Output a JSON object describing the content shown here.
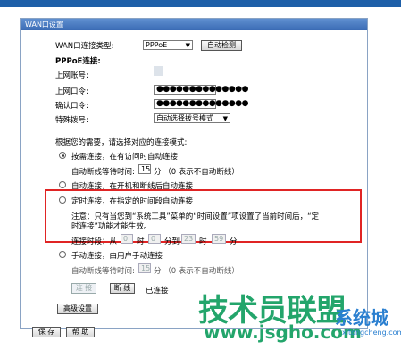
{
  "panel": {
    "title": "WAN口设置"
  },
  "conn_type": {
    "label": "WAN口连接类型:",
    "value": "PPPoE",
    "detect_button": "自动检测"
  },
  "pppoe": {
    "section": "PPPoE连接:",
    "account_label": "上网账号:",
    "password_label": "上网口令:",
    "confirm_label": "确认口令:",
    "password_mask": "●●●●●●●●●●●●●●",
    "special_label": "特殊拨号:",
    "special_value": "自动选择拨号模式"
  },
  "modes": {
    "intro": "根据您的需要，请选择对应的连接模式:",
    "on_demand": "按需连接，在有访问时自动连接",
    "idle_label": "自动断线等待时间:",
    "idle_value": "15",
    "idle_unit": "分 （0 表示不自动断线）",
    "auto": "自动连接，在开机和断线后自动连接",
    "timed": "定时连接，在指定的时间段自动连接",
    "timed_note_1": "注意：只有当您到“系统工具”菜单的“时间设置”项设置了当前时间后，“定",
    "timed_note_2": "时连接”功能才能生效。",
    "period_label": "连接时段：从",
    "from_h": "0",
    "h_unit": "时",
    "from_m": "0",
    "to_label": "分到",
    "to_h": "23",
    "to_m": "59",
    "m_unit": "分",
    "manual": "手动连接，由用户手动连接",
    "manual_idle_value": "15"
  },
  "actions": {
    "connect": "连 接",
    "disconnect": "断 线",
    "status": "已连接",
    "advanced": "高级设置",
    "save": "保 存",
    "help": "帮 助"
  },
  "watermark": {
    "main": "技术员联盟",
    "side": "系统城",
    "url": "www.jsgho.com",
    "site": "xitongcheng.com"
  }
}
